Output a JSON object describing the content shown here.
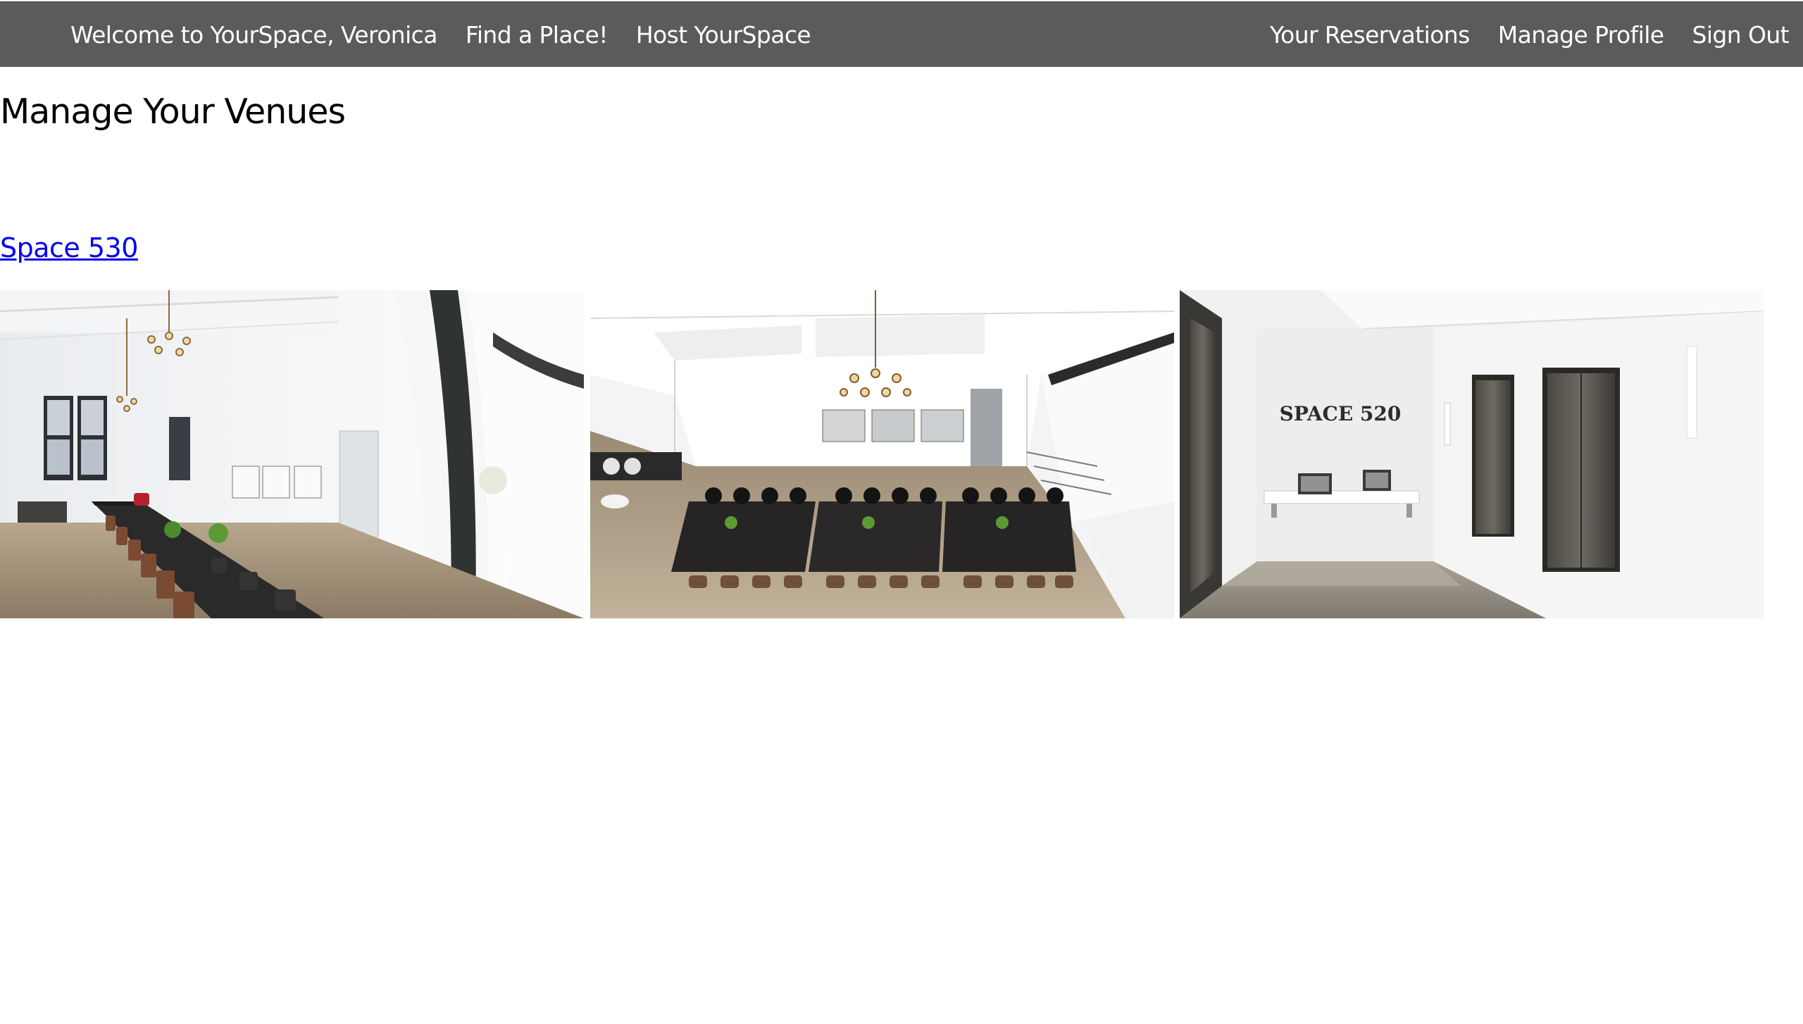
{
  "nav": {
    "welcome": "Welcome to YourSpace, Veronica",
    "find": "Find a Place!",
    "host": "Host YourSpace",
    "reservations": "Your Reservations",
    "profile": "Manage Profile",
    "signout": "Sign Out"
  },
  "page": {
    "title": "Manage Your Venues"
  },
  "venue": {
    "name": "Space 530",
    "photos": [
      {
        "subject": "long conference table with chandeliers in white loft"
      },
      {
        "subject": "overhead view of dark conference tables in loft"
      },
      {
        "subject": "lobby with elevators and bench"
      }
    ],
    "sign_text": "SPACE 520"
  },
  "colors": {
    "navbar": "#5b5b5b",
    "link": "#0000ee"
  }
}
